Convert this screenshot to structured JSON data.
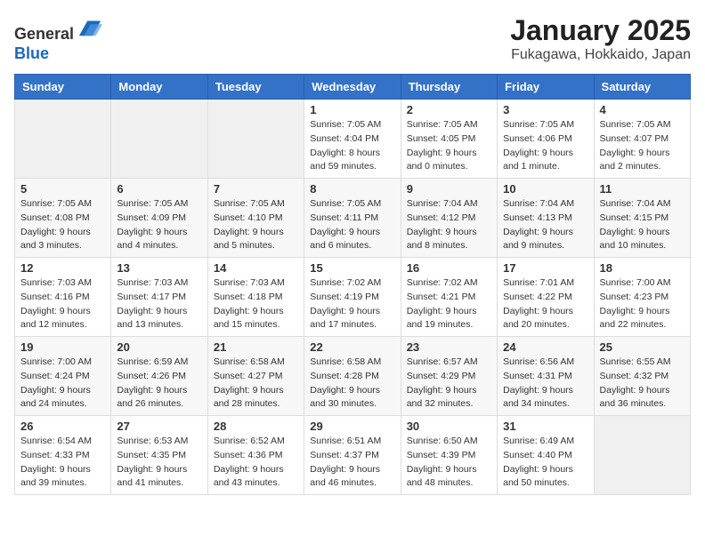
{
  "header": {
    "logo": {
      "line1": "General",
      "line2": "Blue"
    },
    "title": "January 2025",
    "location": "Fukagawa, Hokkaido, Japan"
  },
  "weekdays": [
    "Sunday",
    "Monday",
    "Tuesday",
    "Wednesday",
    "Thursday",
    "Friday",
    "Saturday"
  ],
  "weeks": [
    [
      {
        "day": "",
        "info": ""
      },
      {
        "day": "",
        "info": ""
      },
      {
        "day": "",
        "info": ""
      },
      {
        "day": "1",
        "info": "Sunrise: 7:05 AM\nSunset: 4:04 PM\nDaylight: 8 hours and 59 minutes."
      },
      {
        "day": "2",
        "info": "Sunrise: 7:05 AM\nSunset: 4:05 PM\nDaylight: 9 hours and 0 minutes."
      },
      {
        "day": "3",
        "info": "Sunrise: 7:05 AM\nSunset: 4:06 PM\nDaylight: 9 hours and 1 minute."
      },
      {
        "day": "4",
        "info": "Sunrise: 7:05 AM\nSunset: 4:07 PM\nDaylight: 9 hours and 2 minutes."
      }
    ],
    [
      {
        "day": "5",
        "info": "Sunrise: 7:05 AM\nSunset: 4:08 PM\nDaylight: 9 hours and 3 minutes."
      },
      {
        "day": "6",
        "info": "Sunrise: 7:05 AM\nSunset: 4:09 PM\nDaylight: 9 hours and 4 minutes."
      },
      {
        "day": "7",
        "info": "Sunrise: 7:05 AM\nSunset: 4:10 PM\nDaylight: 9 hours and 5 minutes."
      },
      {
        "day": "8",
        "info": "Sunrise: 7:05 AM\nSunset: 4:11 PM\nDaylight: 9 hours and 6 minutes."
      },
      {
        "day": "9",
        "info": "Sunrise: 7:04 AM\nSunset: 4:12 PM\nDaylight: 9 hours and 8 minutes."
      },
      {
        "day": "10",
        "info": "Sunrise: 7:04 AM\nSunset: 4:13 PM\nDaylight: 9 hours and 9 minutes."
      },
      {
        "day": "11",
        "info": "Sunrise: 7:04 AM\nSunset: 4:15 PM\nDaylight: 9 hours and 10 minutes."
      }
    ],
    [
      {
        "day": "12",
        "info": "Sunrise: 7:03 AM\nSunset: 4:16 PM\nDaylight: 9 hours and 12 minutes."
      },
      {
        "day": "13",
        "info": "Sunrise: 7:03 AM\nSunset: 4:17 PM\nDaylight: 9 hours and 13 minutes."
      },
      {
        "day": "14",
        "info": "Sunrise: 7:03 AM\nSunset: 4:18 PM\nDaylight: 9 hours and 15 minutes."
      },
      {
        "day": "15",
        "info": "Sunrise: 7:02 AM\nSunset: 4:19 PM\nDaylight: 9 hours and 17 minutes."
      },
      {
        "day": "16",
        "info": "Sunrise: 7:02 AM\nSunset: 4:21 PM\nDaylight: 9 hours and 19 minutes."
      },
      {
        "day": "17",
        "info": "Sunrise: 7:01 AM\nSunset: 4:22 PM\nDaylight: 9 hours and 20 minutes."
      },
      {
        "day": "18",
        "info": "Sunrise: 7:00 AM\nSunset: 4:23 PM\nDaylight: 9 hours and 22 minutes."
      }
    ],
    [
      {
        "day": "19",
        "info": "Sunrise: 7:00 AM\nSunset: 4:24 PM\nDaylight: 9 hours and 24 minutes."
      },
      {
        "day": "20",
        "info": "Sunrise: 6:59 AM\nSunset: 4:26 PM\nDaylight: 9 hours and 26 minutes."
      },
      {
        "day": "21",
        "info": "Sunrise: 6:58 AM\nSunset: 4:27 PM\nDaylight: 9 hours and 28 minutes."
      },
      {
        "day": "22",
        "info": "Sunrise: 6:58 AM\nSunset: 4:28 PM\nDaylight: 9 hours and 30 minutes."
      },
      {
        "day": "23",
        "info": "Sunrise: 6:57 AM\nSunset: 4:29 PM\nDaylight: 9 hours and 32 minutes."
      },
      {
        "day": "24",
        "info": "Sunrise: 6:56 AM\nSunset: 4:31 PM\nDaylight: 9 hours and 34 minutes."
      },
      {
        "day": "25",
        "info": "Sunrise: 6:55 AM\nSunset: 4:32 PM\nDaylight: 9 hours and 36 minutes."
      }
    ],
    [
      {
        "day": "26",
        "info": "Sunrise: 6:54 AM\nSunset: 4:33 PM\nDaylight: 9 hours and 39 minutes."
      },
      {
        "day": "27",
        "info": "Sunrise: 6:53 AM\nSunset: 4:35 PM\nDaylight: 9 hours and 41 minutes."
      },
      {
        "day": "28",
        "info": "Sunrise: 6:52 AM\nSunset: 4:36 PM\nDaylight: 9 hours and 43 minutes."
      },
      {
        "day": "29",
        "info": "Sunrise: 6:51 AM\nSunset: 4:37 PM\nDaylight: 9 hours and 46 minutes."
      },
      {
        "day": "30",
        "info": "Sunrise: 6:50 AM\nSunset: 4:39 PM\nDaylight: 9 hours and 48 minutes."
      },
      {
        "day": "31",
        "info": "Sunrise: 6:49 AM\nSunset: 4:40 PM\nDaylight: 9 hours and 50 minutes."
      },
      {
        "day": "",
        "info": ""
      }
    ]
  ]
}
